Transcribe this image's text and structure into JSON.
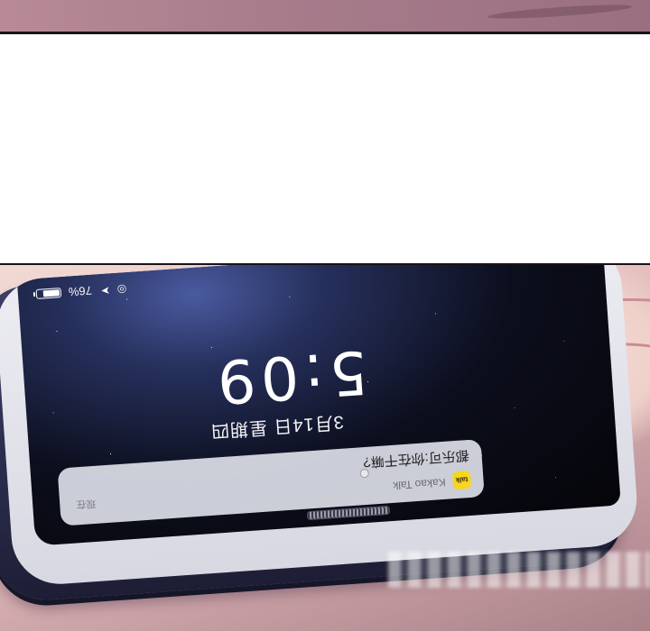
{
  "phone": {
    "notification": {
      "app_name": "Kakao Talk",
      "icon_label": "talk",
      "sender": "都乐可:你在干嘛?",
      "time": "现在"
    },
    "lock_date": "3月14日 星期四",
    "lock_time": "5:09",
    "status_bar": {
      "battery_percent": "76%",
      "battery_level": 0.76
    }
  },
  "colors": {
    "kakao_yellow": "#f7d61e",
    "phone_frame": "#2a2c4b",
    "screen_dark": "#0c0e1c"
  }
}
